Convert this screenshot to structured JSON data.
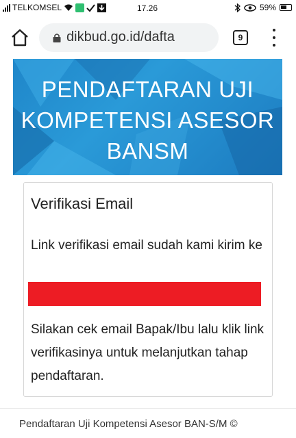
{
  "status_bar": {
    "carrier": "TELKOMSEL",
    "time": "17.26",
    "battery": "59%"
  },
  "browser": {
    "url": "dikbud.go.id/dafta",
    "tab_count": "9"
  },
  "page": {
    "banner_title": "PENDAFTARAN UJI KOMPETENSI ASESOR BANSM",
    "card": {
      "title": "Verifikasi Email",
      "message_1": "Link verifikasi email sudah kami kirim ke",
      "message_2": "Silakan cek email Bapak/Ibu lalu klik link verifikasinya untuk melanjutkan tahap pendaftaran."
    },
    "footer": "Pendaftaran Uji Kompetensi Asesor BAN-S/M ©"
  },
  "colors": {
    "banner_blue": "#2a9ad8",
    "redaction_red": "#ed1c24"
  }
}
